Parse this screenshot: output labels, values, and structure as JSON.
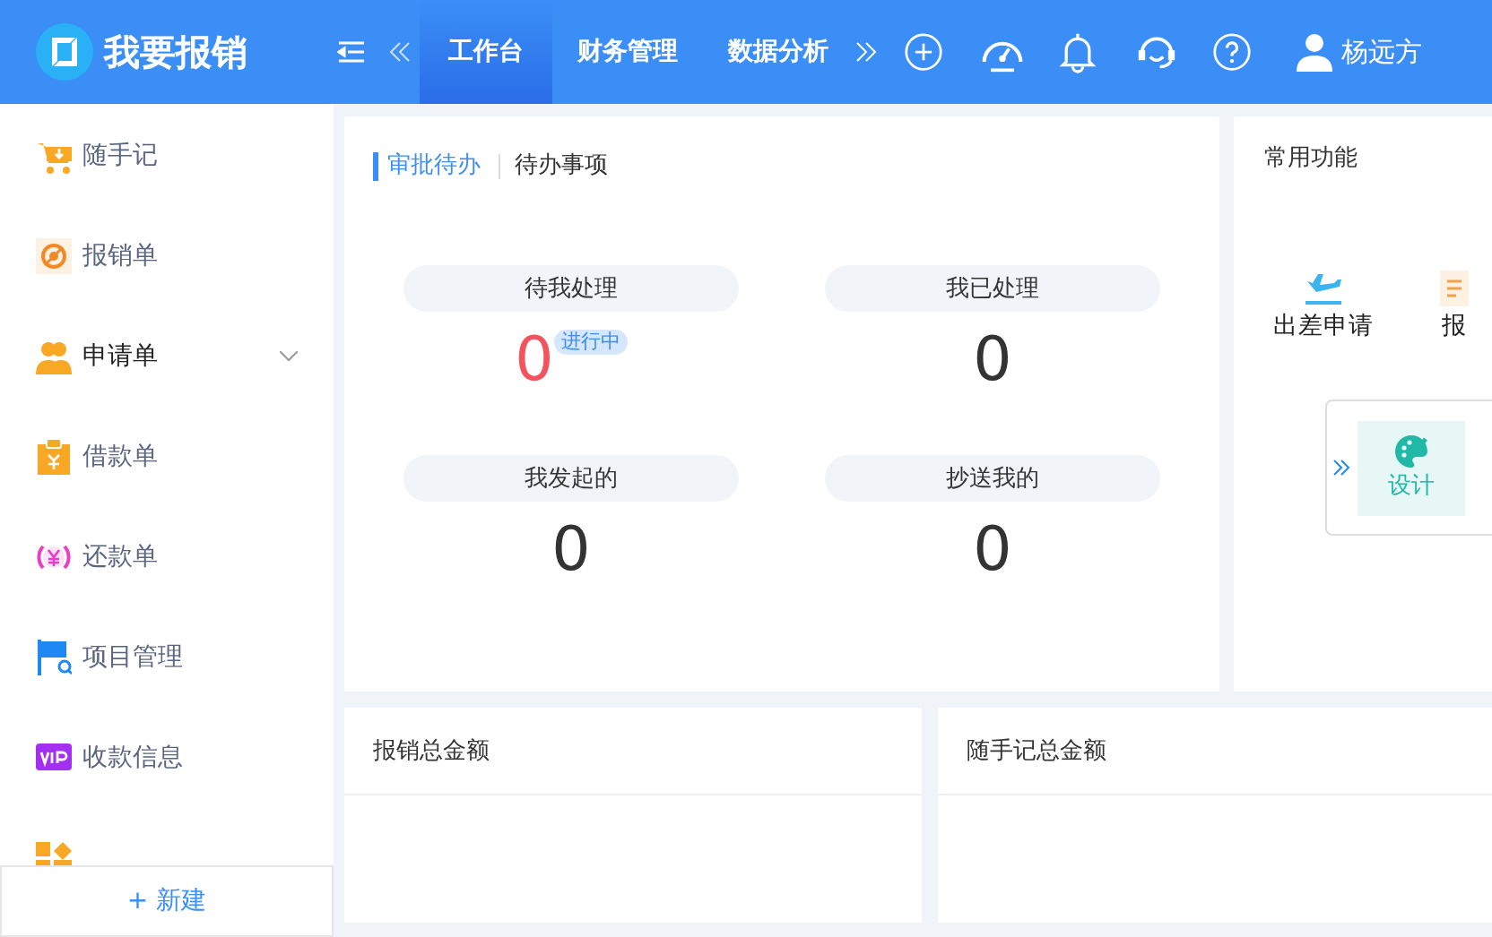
{
  "header": {
    "logo": "我要报销",
    "nav_tabs": [
      {
        "label": "工作台",
        "selected": true
      },
      {
        "label": "财务管理",
        "selected": false
      },
      {
        "label": "数据分析",
        "selected": false
      }
    ],
    "user": {
      "name": "杨远方"
    }
  },
  "sidebar": {
    "items": [
      {
        "label": "随手记",
        "kind": "cart",
        "selected": false
      },
      {
        "label": "报销单",
        "kind": "target",
        "selected": false
      },
      {
        "label": "申请单",
        "kind": "people",
        "selected": true,
        "expandable": true
      },
      {
        "label": "借款单",
        "kind": "clipboard",
        "selected": false
      },
      {
        "label": "还款单",
        "kind": "coin",
        "selected": false
      },
      {
        "label": "项目管理",
        "kind": "flag",
        "selected": false
      },
      {
        "label": "收款信息",
        "kind": "vip",
        "selected": false
      },
      {
        "kind": "blocks"
      }
    ],
    "new_button": "+ 新建"
  },
  "approval_card": {
    "tabs": [
      {
        "label": "审批待办",
        "selected": true
      },
      {
        "label": "待办事项",
        "selected": false
      }
    ],
    "stats": [
      {
        "label": "待我处理",
        "value": "0",
        "alert": true,
        "badge": "进行中"
      },
      {
        "label": "我已处理",
        "value": "0",
        "alert": false
      },
      {
        "label": "我发起的",
        "value": "0",
        "alert": false
      },
      {
        "label": "抄送我的",
        "value": "0",
        "alert": false
      }
    ]
  },
  "common_functions": {
    "title": "常用功能",
    "items": [
      {
        "label": "出差申请",
        "kind": "plane"
      },
      {
        "label": "报",
        "kind": "expense"
      }
    ],
    "floating_panel": {
      "label": "设计"
    }
  },
  "summary_cards": [
    {
      "title": "报销总金额"
    },
    {
      "title": "随手记总金额"
    }
  ]
}
